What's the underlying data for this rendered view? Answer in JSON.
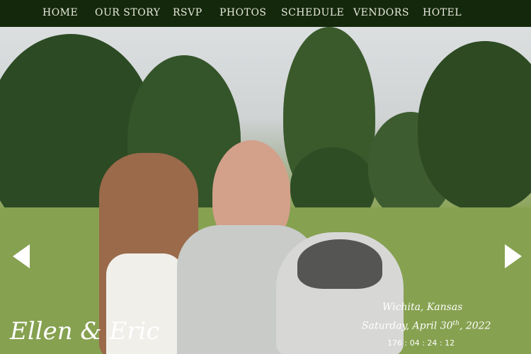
{
  "nav": {
    "items": [
      {
        "label": "HOME"
      },
      {
        "label": "OUR STORY"
      },
      {
        "label": "RSVP"
      },
      {
        "label": "PHOTOS"
      },
      {
        "label": "SCHEDULE"
      },
      {
        "label": "VENDORS"
      },
      {
        "label": "HOTEL"
      }
    ]
  },
  "hero": {
    "couple_name": "Ellen & Eric",
    "location": "Wichita, Kansas",
    "date_main": "Saturday, April 30",
    "date_suffix": "th",
    "date_year": ", 2022",
    "countdown": "176 : 04 : 24 : 12"
  },
  "colors": {
    "nav_bg": "#14280b",
    "nav_text": "#e8eadf"
  }
}
